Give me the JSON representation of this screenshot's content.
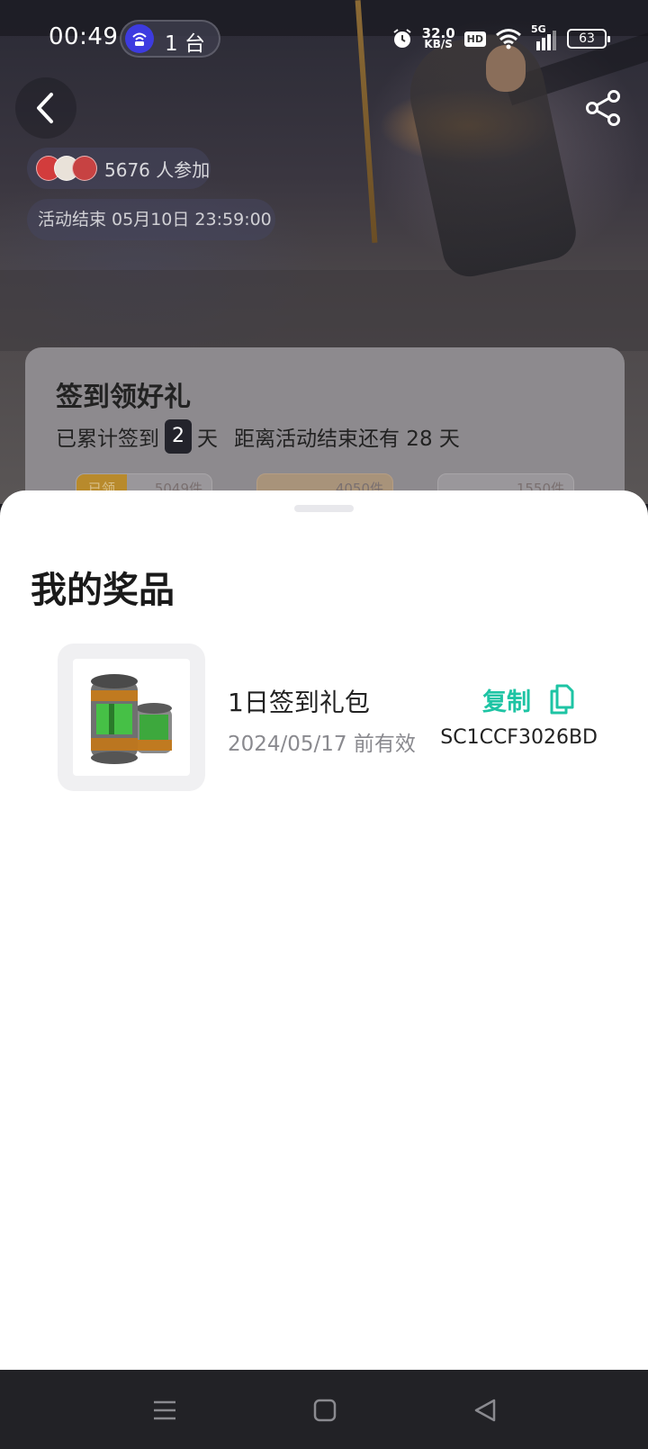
{
  "status_bar": {
    "time": "00:49",
    "hotspot_label": "1 台",
    "net_speed_value": "32.0",
    "net_speed_unit": "KB/S",
    "hd_label": "HD",
    "signal_label": "5G",
    "battery_level": "63",
    "icons": [
      "hotspot-icon",
      "alarm-icon",
      "wifi-icon",
      "signal-icon",
      "battery-icon"
    ]
  },
  "header": {
    "participants_text": "5676 人参加",
    "end_time_text": "活动结束 05月10日 23:59:00"
  },
  "checkin_card": {
    "title": "签到领好礼",
    "sub_prefix": "已累计签到",
    "days": "2",
    "day_unit": "天",
    "remaining_text": "距离活动结束还有 28 天",
    "chips": [
      {
        "tag": "已领",
        "count": "5049件"
      },
      {
        "tag": "",
        "count": "4050件"
      },
      {
        "tag": "",
        "count": "1550件"
      }
    ]
  },
  "sheet": {
    "title": "我的奖品",
    "prizes": [
      {
        "name": "1日签到礼包",
        "valid_until": "2024/05/17 前有效",
        "copy_label": "复制",
        "code": "SC1CCF3026BD"
      }
    ]
  },
  "colors": {
    "accent": "#1ec4a4",
    "sheet_bg": "#ffffff",
    "nav_bar_bg": "#222226"
  }
}
